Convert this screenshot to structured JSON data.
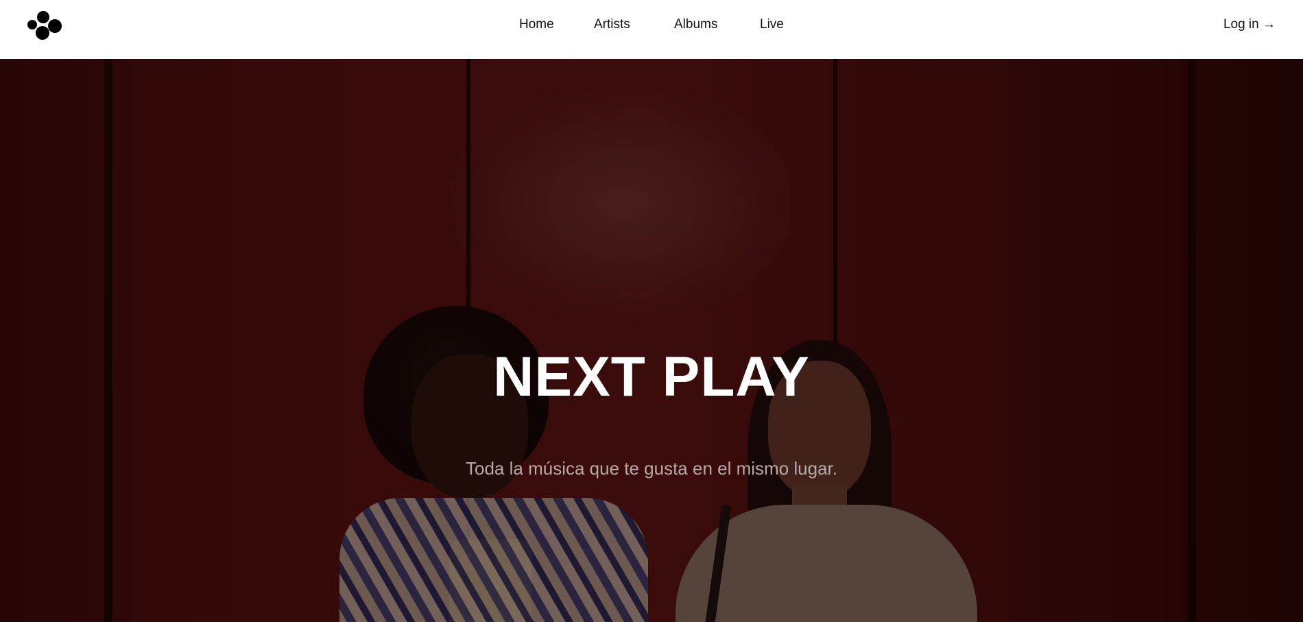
{
  "nav": {
    "logo_icon": "logo-dots-icon",
    "links": [
      "Home",
      "Artists",
      "Albums",
      "Live"
    ],
    "login_label": "Log in →"
  },
  "hero": {
    "title": "NEXT PLAY",
    "subtitle": "Toda la música que te gusta en el mismo lugar.",
    "background_color": "#571111"
  }
}
